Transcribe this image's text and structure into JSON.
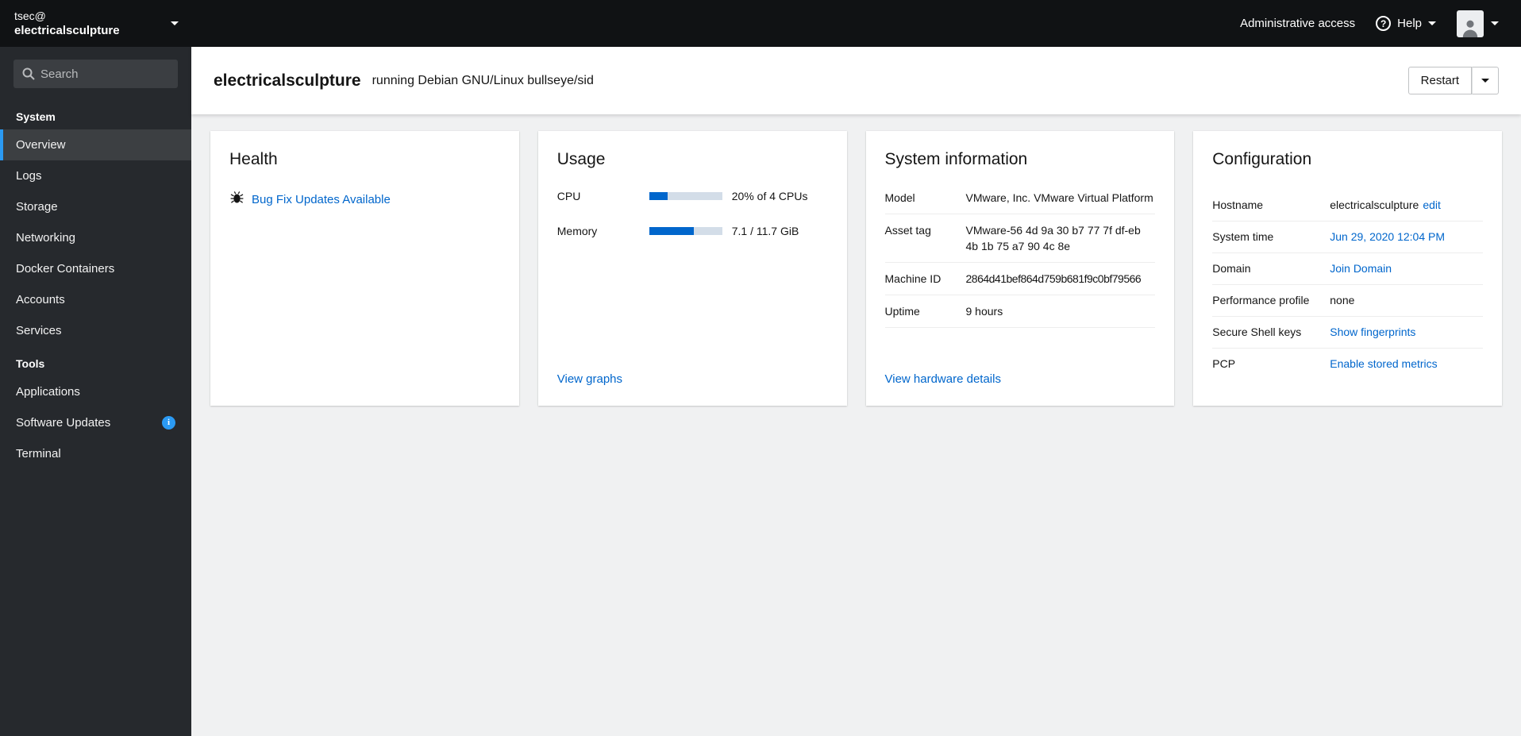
{
  "sidebar": {
    "user": {
      "line1": "tsec@",
      "line2": "electricalsculpture"
    },
    "search_placeholder": "Search",
    "sections": [
      {
        "label": "System",
        "items": [
          {
            "label": "Overview",
            "active": true
          },
          {
            "label": "Logs"
          },
          {
            "label": "Storage"
          },
          {
            "label": "Networking"
          },
          {
            "label": "Docker Containers"
          },
          {
            "label": "Accounts"
          },
          {
            "label": "Services"
          }
        ]
      },
      {
        "label": "Tools",
        "items": [
          {
            "label": "Applications"
          },
          {
            "label": "Software Updates",
            "badge": true
          },
          {
            "label": "Terminal"
          }
        ]
      }
    ]
  },
  "masthead": {
    "admin_access": "Administrative access",
    "help": "Help"
  },
  "header": {
    "hostname": "electricalsculpture",
    "subtitle": "running Debian GNU/Linux bullseye/sid",
    "restart": "Restart"
  },
  "cards": {
    "health": {
      "title": "Health",
      "update_link": "Bug Fix Updates Available"
    },
    "usage": {
      "title": "Usage",
      "rows": [
        {
          "label": "CPU",
          "value": "20% of 4 CPUs",
          "percent": 25
        },
        {
          "label": "Memory",
          "value": "7.1 / 11.7 GiB",
          "percent": 61
        }
      ],
      "link": "View graphs"
    },
    "system_info": {
      "title": "System information",
      "rows": [
        {
          "label": "Model",
          "value": "VMware, Inc. VMware Virtual Platform"
        },
        {
          "label": "Asset tag",
          "value": "VMware-56 4d 9a 30 b7 77 7f df-eb 4b 1b 75 a7 90 4c 8e"
        },
        {
          "label": "Machine ID",
          "value": "2864d41bef864d759b681f9c0bf79566",
          "tight": true
        },
        {
          "label": "Uptime",
          "value": "9 hours"
        }
      ],
      "link": "View hardware details"
    },
    "configuration": {
      "title": "Configuration",
      "rows": [
        {
          "label": "Hostname",
          "parts": [
            {
              "type": "text",
              "text": "electricalsculpture"
            },
            {
              "type": "link",
              "text": "edit",
              "name": "edit-hostname-link"
            }
          ]
        },
        {
          "label": "System time",
          "parts": [
            {
              "type": "link",
              "text": "Jun 29, 2020 12:04 PM",
              "name": "system-time-link"
            }
          ]
        },
        {
          "label": "Domain",
          "parts": [
            {
              "type": "link",
              "text": "Join Domain",
              "name": "join-domain-link"
            }
          ]
        },
        {
          "label": "Performance profile",
          "parts": [
            {
              "type": "text",
              "text": "none"
            }
          ]
        },
        {
          "label": "Secure Shell keys",
          "parts": [
            {
              "type": "link",
              "text": "Show fingerprints",
              "name": "show-fingerprints-link"
            }
          ]
        },
        {
          "label": "PCP",
          "parts": [
            {
              "type": "link",
              "text": "Enable stored metrics",
              "name": "enable-stored-metrics-link"
            }
          ]
        }
      ]
    }
  },
  "colors": {
    "accent_blue": "#0066cc",
    "nav_active_border": "#2b9af3",
    "masthead_bg": "#101214",
    "sidebar_bg": "#26292d",
    "content_bg": "#f0f1f2",
    "progress_fill": "#0066cc",
    "progress_track": "#d3dde8",
    "info_badge": "#2b9af3"
  }
}
